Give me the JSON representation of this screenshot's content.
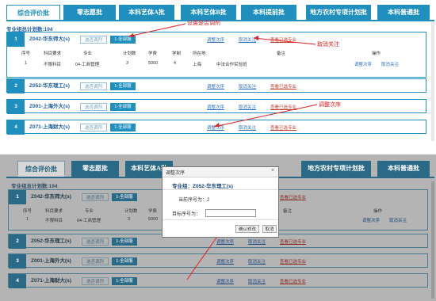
{
  "tabs": [
    "综合评价批",
    "零志愿批",
    "本科艺体A批",
    "本科艺体B批",
    "本科提前批",
    "地方农村专项计划批",
    "本科普通批"
  ],
  "plan_total": "专业组总计划数:194",
  "groups": [
    {
      "num": "1",
      "name": "Z042-华东师大(s)",
      "btn_select": "选否调剂",
      "btn_active": "1-全部服"
    },
    {
      "num": "2",
      "name": "Z052-华东理工(s)",
      "btn_select": "选否调剂",
      "btn_active": "1-全部服"
    },
    {
      "num": "3",
      "name": "Z001-上海外大(s)",
      "btn_select": "选否调剂",
      "btn_active": "1-全部服"
    },
    {
      "num": "4",
      "name": "Z071-上海财大(s)",
      "btn_select": "选否调剂",
      "btn_active": "1-全部服"
    }
  ],
  "links": {
    "adjust": "调整次序",
    "cancel": "取消关注",
    "view": "查看已选专业"
  },
  "table_headers": [
    "序号",
    "科目要求",
    "专业",
    "计划数",
    "学费",
    "学制",
    "所在地",
    "备注",
    "操作"
  ],
  "table_row": {
    "idx": "1",
    "subject": "不限科目",
    "major": "04-工商管理",
    "plan": "3",
    "fee": "5000",
    "years": "4",
    "location": "上海",
    "note": "中法合作实验班",
    "op_adjust": "调整次序",
    "op_cancel": "取消关注"
  },
  "annotations": {
    "set_adjust": "设置是否调剂",
    "cancel_follow": "取消关注",
    "adjust_order": "调整次序"
  },
  "dialog": {
    "title": "调整次序",
    "group": "专业组：Z052-华东理工(s)",
    "current": "当前序号为：2",
    "target_label": "目标序号为：",
    "target_value": "",
    "confirm": "确认修改",
    "cancel": "取消"
  },
  "colors": {
    "accent": "#1e8fbf",
    "link": "#2a6fc0",
    "annotation": "#e02020"
  }
}
